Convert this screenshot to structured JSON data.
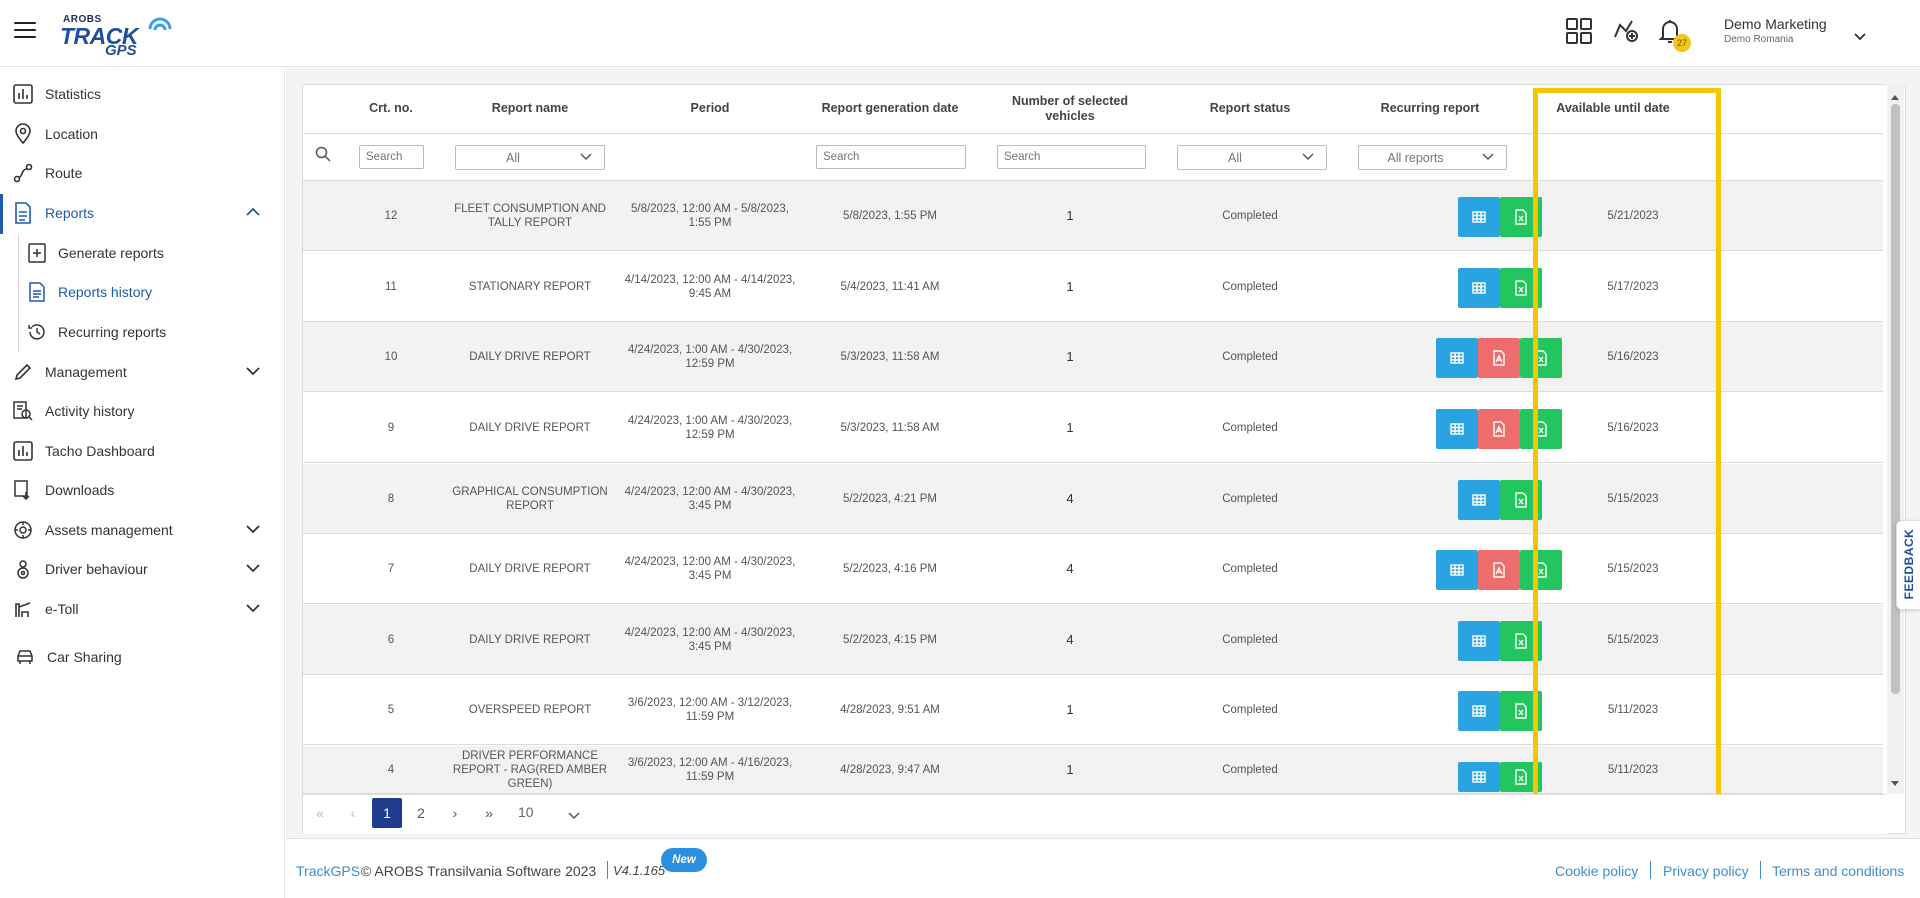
{
  "header": {
    "logo": {
      "top": "AROBS",
      "main": "TRACK",
      "sub": "GPS"
    },
    "notification_count": "27",
    "user": {
      "name": "Demo Marketing",
      "org": "Demo Romania"
    }
  },
  "sidebar": {
    "items": [
      {
        "label": "Statistics"
      },
      {
        "label": "Location"
      },
      {
        "label": "Route"
      },
      {
        "label": "Reports"
      },
      {
        "label": "Generate reports"
      },
      {
        "label": "Reports history"
      },
      {
        "label": "Recurring reports"
      },
      {
        "label": "Management"
      },
      {
        "label": "Activity history"
      },
      {
        "label": "Tacho Dashboard"
      },
      {
        "label": "Downloads"
      },
      {
        "label": "Assets management"
      },
      {
        "label": "Driver behaviour"
      },
      {
        "label": "e-Toll"
      },
      {
        "label": "Car Sharing"
      }
    ]
  },
  "table": {
    "columns": [
      "Crt. no.",
      "Report name",
      "Period",
      "Report generation date",
      "Number of selected vehicles",
      "Report status",
      "Recurring report",
      "Available until date"
    ],
    "filters": {
      "crt_placeholder": "Search",
      "name_value": "All",
      "gen_date_placeholder": "Search",
      "vehicles_placeholder": "Search",
      "status_value": "All",
      "recurring_value": "All reports"
    },
    "rows": [
      {
        "no": "12",
        "name": "FLEET CONSUMPTION AND TALLY REPORT",
        "period": "5/8/2023, 12:00 AM - 5/8/2023, 1:55 PM",
        "generated": "5/8/2023, 1:55 PM",
        "vehicles": "1",
        "status": "Completed",
        "recurring": "",
        "available": "5/21/2023"
      },
      {
        "no": "11",
        "name": "STATIONARY REPORT",
        "period": "4/14/2023, 12:00 AM - 4/14/2023, 9:45 AM",
        "generated": "5/4/2023, 11:41 AM",
        "vehicles": "1",
        "status": "Completed",
        "recurring": "",
        "available": "5/17/2023"
      },
      {
        "no": "10",
        "name": "DAILY DRIVE REPORT",
        "period": "4/24/2023, 1:00 AM - 4/30/2023, 12:59 PM",
        "generated": "5/3/2023, 11:58 AM",
        "vehicles": "1",
        "status": "Completed",
        "recurring": "",
        "available": "5/16/2023"
      },
      {
        "no": "9",
        "name": "DAILY DRIVE REPORT",
        "period": "4/24/2023, 1:00 AM - 4/30/2023, 12:59 PM",
        "generated": "5/3/2023, 11:58 AM",
        "vehicles": "1",
        "status": "Completed",
        "recurring": "",
        "available": "5/16/2023"
      },
      {
        "no": "8",
        "name": "GRAPHICAL CONSUMPTION REPORT",
        "period": "4/24/2023, 12:00 AM - 4/30/2023, 3:45 PM",
        "generated": "5/2/2023, 4:21 PM",
        "vehicles": "4",
        "status": "Completed",
        "recurring": "",
        "available": "5/15/2023"
      },
      {
        "no": "7",
        "name": "DAILY DRIVE REPORT",
        "period": "4/24/2023, 12:00 AM - 4/30/2023, 3:45 PM",
        "generated": "5/2/2023, 4:16 PM",
        "vehicles": "4",
        "status": "Completed",
        "recurring": "",
        "available": "5/15/2023"
      },
      {
        "no": "6",
        "name": "DAILY DRIVE REPORT",
        "period": "4/24/2023, 12:00 AM - 4/30/2023, 3:45 PM",
        "generated": "5/2/2023, 4:15 PM",
        "vehicles": "4",
        "status": "Completed",
        "recurring": "",
        "available": "5/15/2023"
      },
      {
        "no": "5",
        "name": "OVERSPEED REPORT",
        "period": "3/6/2023, 12:00 AM - 3/12/2023, 11:59 PM",
        "generated": "4/28/2023, 9:51 AM",
        "vehicles": "1",
        "status": "Completed",
        "recurring": "",
        "available": "5/11/2023"
      },
      {
        "no": "4",
        "name": "DRIVER PERFORMANCE REPORT - RAG(RED AMBER GREEN)",
        "period": "3/6/2023, 12:00 AM - 4/16/2023, 11:59 PM",
        "generated": "4/28/2023, 9:47 AM",
        "vehicles": "1",
        "status": "Completed",
        "recurring": "",
        "available": "5/11/2023"
      }
    ]
  },
  "pagination": {
    "pages": [
      "1",
      "2"
    ],
    "current": "1",
    "page_size": "10"
  },
  "footer": {
    "brand": "TrackGPS",
    "copyright": "© AROBS Transilvania Software 2023",
    "version": "V4.1.165",
    "new_badge": "New",
    "links": [
      "Cookie policy",
      "Privacy policy",
      "Terms and conditions"
    ]
  },
  "feedback_label": "FEEDBACK",
  "colors": {
    "accent": "#1f5aa8",
    "highlight": "#f7c600",
    "btn_table": "#2aa3e3",
    "btn_pdf": "#ef6c6c",
    "btn_excel": "#22c55e"
  }
}
